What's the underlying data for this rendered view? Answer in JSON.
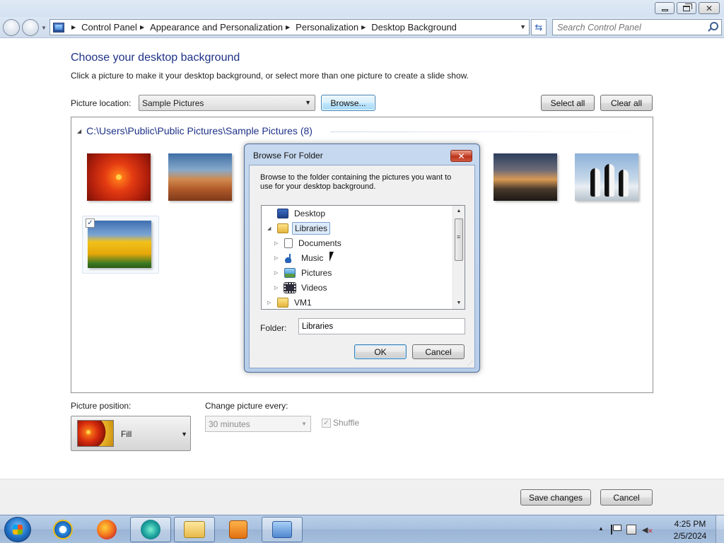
{
  "address": {
    "crumbs": [
      "Control Panel",
      "Appearance and Personalization",
      "Personalization",
      "Desktop Background"
    ],
    "search_placeholder": "Search Control Panel"
  },
  "page": {
    "title": "Choose your desktop background",
    "subtitle": "Click a picture to make it your desktop background, or select more than one picture to create a slide show.",
    "location_label": "Picture location:",
    "location_value": "Sample Pictures",
    "browse_label": "Browse...",
    "select_all_label": "Select all",
    "clear_all_label": "Clear all",
    "group_header": "C:\\Users\\Public\\Public Pictures\\Sample Pictures (8)",
    "position_label": "Picture position:",
    "position_value": "Fill",
    "interval_label": "Change picture every:",
    "interval_value": "30 minutes",
    "shuffle_label": "Shuffle",
    "save_label": "Save changes",
    "cancel_label": "Cancel"
  },
  "dialog": {
    "title": "Browse For Folder",
    "instructions": "Browse to the folder containing the pictures you want to use for your desktop background.",
    "tree": [
      "Desktop",
      "Libraries",
      "Documents",
      "Music",
      "Pictures",
      "Videos",
      "VM1"
    ],
    "selected": "Libraries",
    "folder_label": "Folder:",
    "folder_value": "Libraries",
    "ok_label": "OK",
    "cancel_label": "Cancel"
  },
  "tray": {
    "time": "4:25 PM",
    "date": "2/5/2024"
  },
  "colors": {
    "title_blue": "#1e3287",
    "selection": "#dceaf9"
  }
}
